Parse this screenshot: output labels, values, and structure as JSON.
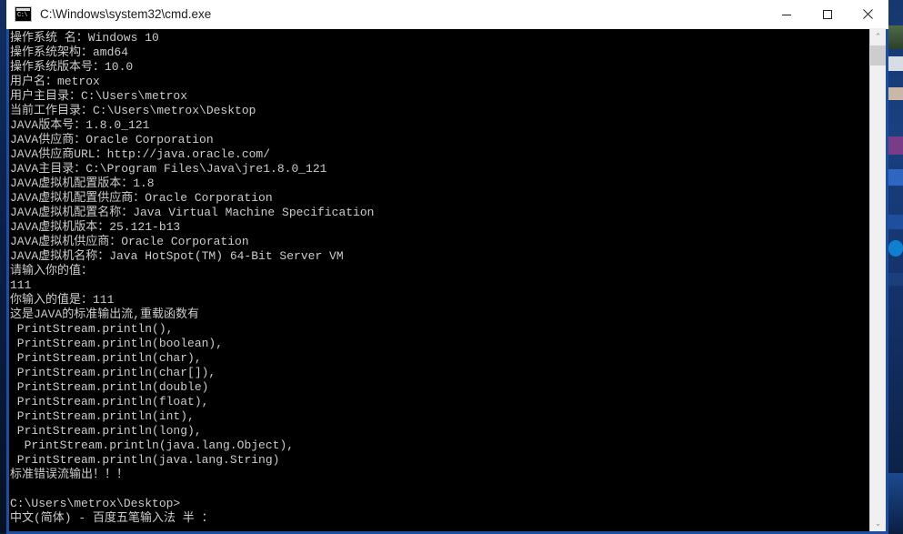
{
  "window": {
    "title": "C:\\Windows\\system32\\cmd.exe",
    "icon": "cmd-icon",
    "icon_glyph": "C:\\",
    "minimize_label": "—",
    "maximize_label": "□",
    "close_label": "✕",
    "border_color": "#1f4e9e",
    "titlebar_bg": "#ffffff",
    "console_bg": "#000000",
    "console_fg": "#cccccc"
  },
  "scrollbar": {
    "up_arrow": "⌃",
    "down_arrow": "⌄",
    "thumb_color": "#cdcdcd",
    "track_color": "#f0f0f0"
  },
  "console": {
    "lines": [
      "操作系统 名：Windows 10",
      "操作系统架构：amd64",
      "操作系统版本号：10.0",
      "用户名：metrox",
      "用户主目录：C:\\Users\\metrox",
      "当前工作目录：C:\\Users\\metrox\\Desktop",
      "JAVA版本号：1.8.0_121",
      "JAVA供应商：Oracle Corporation",
      "JAVA供应商URL：http://java.oracle.com/",
      "JAVA主目录：C:\\Program Files\\Java\\jre1.8.0_121",
      "JAVA虚拟机配置版本：1.8",
      "JAVA虚拟机配置供应商：Oracle Corporation",
      "JAVA虚拟机配置名称：Java Virtual Machine Specification",
      "JAVA虚拟机版本：25.121-b13",
      "JAVA虚拟机供应商：Oracle Corporation",
      "JAVA虚拟机名称：Java HotSpot(TM) 64-Bit Server VM",
      "请输入你的值：",
      "111",
      "你输入的值是：111",
      "这是JAVA的标准输出流,重载函数有",
      " PrintStream.println(),",
      " PrintStream.println(boolean),",
      " PrintStream.println(char),",
      " PrintStream.println(char[]),",
      " PrintStream.println(double)",
      " PrintStream.println(float),",
      " PrintStream.println(int),",
      " PrintStream.println(long),",
      "  PrintStream.println(java.lang.Object),",
      " PrintStream.println(java.lang.String)",
      "标准错误流输出！！！",
      "",
      "C:\\Users\\metrox\\Desktop>",
      "中文(简体) - 百度五笔输入法 半 ："
    ]
  }
}
